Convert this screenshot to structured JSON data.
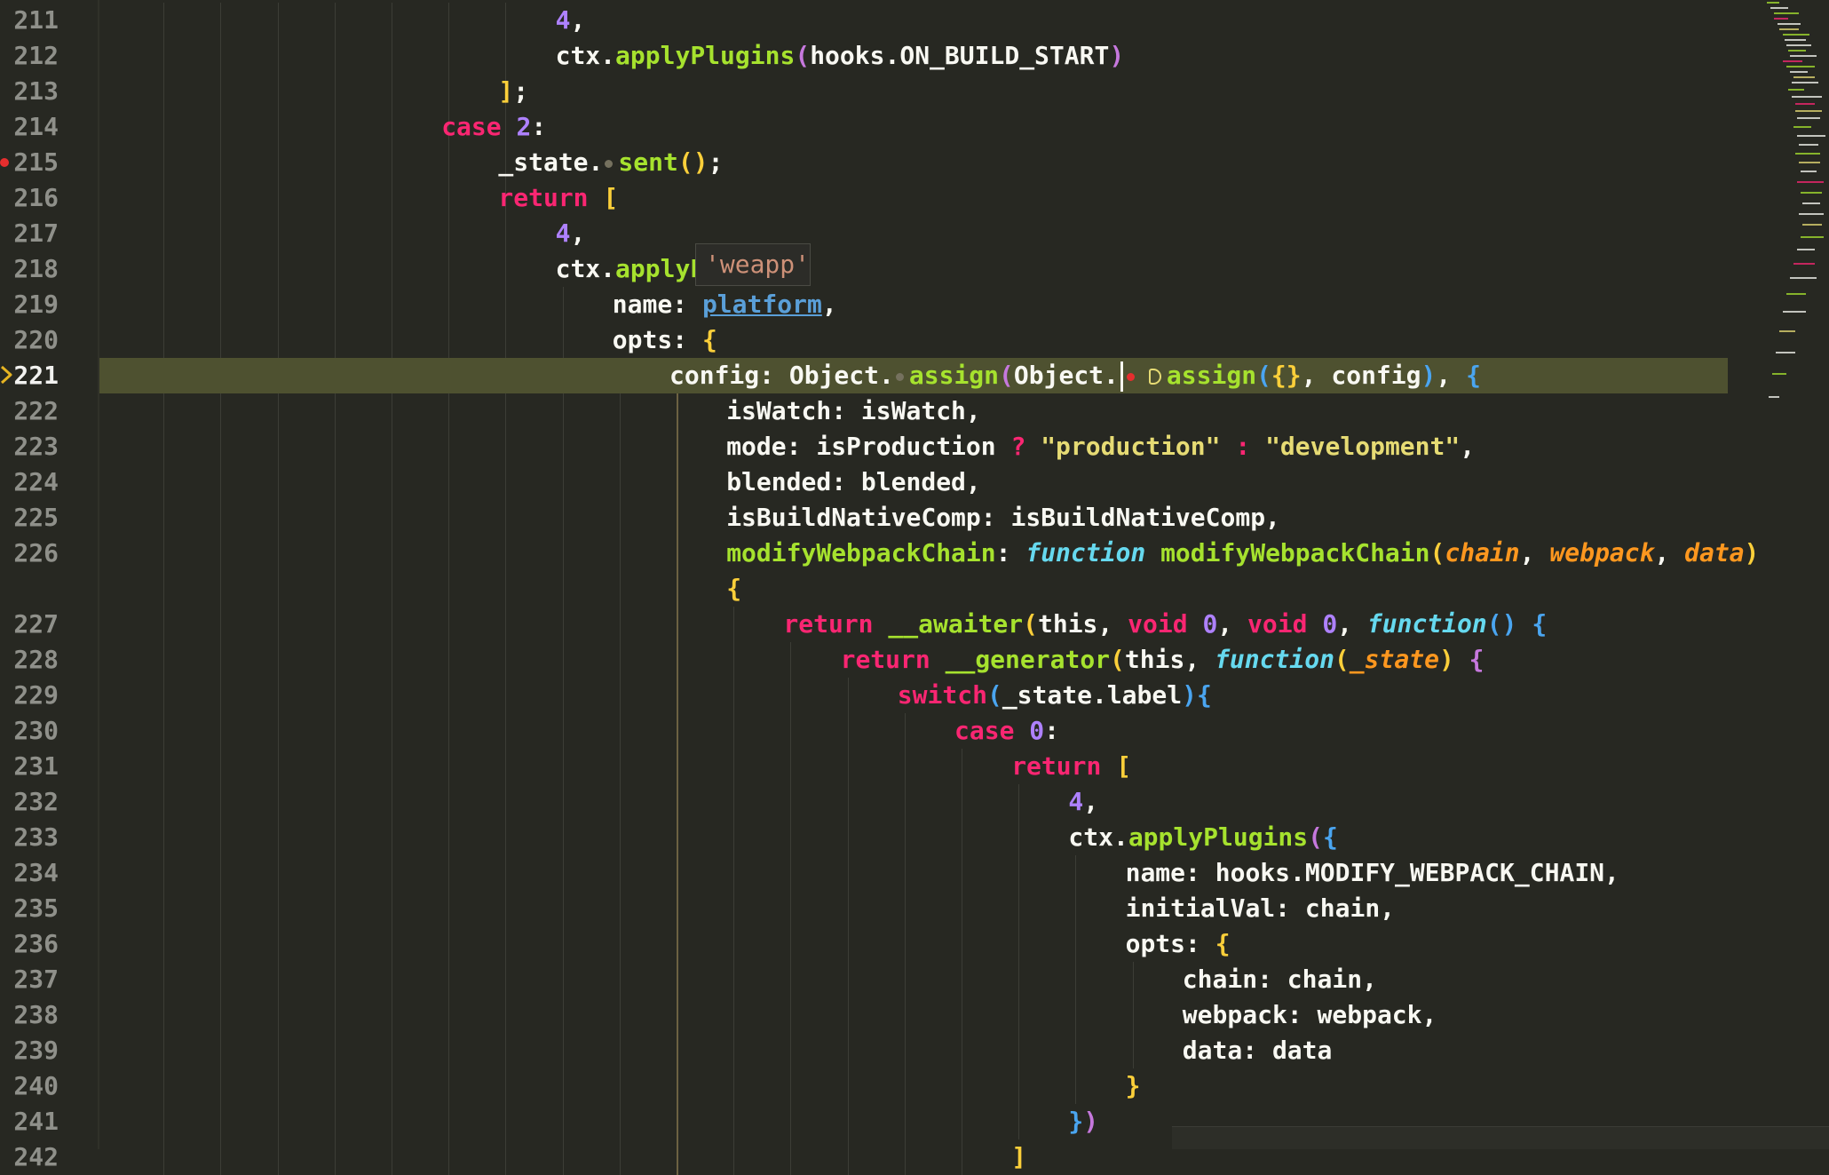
{
  "editor": {
    "colors": {
      "background": "#272822",
      "line_highlight": "#4e5130",
      "plain": "#f8f8f2",
      "keyword": "#f92672",
      "number": "#ae81ff",
      "function": "#a6e22e",
      "string": "#e6db74",
      "storage": "#66d9ef",
      "param": "#fd971f",
      "bracket1": "#fbcf3a",
      "bracket2": "#c678dd",
      "bracket3": "#4aa5f0"
    },
    "tooltip": {
      "text": "'weapp'"
    },
    "breakpoint_line": "215",
    "current_line": "221",
    "lines": [
      {
        "num": "211",
        "indent": 8,
        "tokens": [
          [
            "4",
            "n"
          ],
          [
            ",",
            "p"
          ]
        ]
      },
      {
        "num": "212",
        "indent": 8,
        "tokens": [
          [
            "ctx",
            "p"
          ],
          [
            ".",
            "p"
          ],
          [
            "applyPlugins",
            "f"
          ],
          [
            "(",
            "b2"
          ],
          [
            "hooks.ON_BUILD_START",
            "p"
          ],
          [
            ")",
            "b2"
          ]
        ]
      },
      {
        "num": "213",
        "indent": 7,
        "tokens": [
          [
            "]",
            "b1"
          ],
          [
            ";",
            "p"
          ]
        ]
      },
      {
        "num": "214",
        "indent": 6,
        "tokens": [
          [
            "case ",
            "k"
          ],
          [
            "2",
            "n"
          ],
          [
            ":",
            "p"
          ]
        ]
      },
      {
        "num": "215",
        "indent": 7,
        "tokens": [
          [
            "_state.",
            "p"
          ],
          [
            "@dot",
            ""
          ],
          [
            "sent",
            "f"
          ],
          [
            "()",
            "b1"
          ],
          [
            ";",
            "p"
          ]
        ]
      },
      {
        "num": "216",
        "indent": 7,
        "tokens": [
          [
            "return ",
            "k"
          ],
          [
            "[",
            "b1"
          ]
        ]
      },
      {
        "num": "217",
        "indent": 8,
        "tokens": [
          [
            "4",
            "n"
          ],
          [
            ",",
            "p"
          ]
        ]
      },
      {
        "num": "218",
        "indent": 8,
        "tokens": [
          [
            "ctx.",
            "p"
          ],
          [
            "applyP",
            "f"
          ]
        ]
      },
      {
        "num": "219",
        "indent": 9,
        "tokens": [
          [
            "name: ",
            "p"
          ],
          [
            "platform",
            "link"
          ],
          [
            ",",
            "p"
          ]
        ]
      },
      {
        "num": "220",
        "indent": 9,
        "tokens": [
          [
            "opts: ",
            "p"
          ],
          [
            "{",
            "b1"
          ]
        ]
      },
      {
        "num": "221",
        "indent": 10,
        "tokens": [
          [
            "config: Object.",
            "p"
          ],
          [
            "@dot",
            ""
          ],
          [
            "assign",
            "f"
          ],
          [
            "(",
            "b2"
          ],
          [
            "Object.",
            "p"
          ],
          [
            "@cursor",
            ""
          ],
          [
            "@reddot",
            ""
          ],
          [
            "@hint",
            ""
          ],
          [
            "assign",
            "f"
          ],
          [
            "(",
            "b3"
          ],
          [
            "{}",
            "b1"
          ],
          [
            ", config",
            "p"
          ],
          [
            ")",
            "b3"
          ],
          [
            ", ",
            "p"
          ],
          [
            "{",
            "b3"
          ]
        ]
      },
      {
        "num": "222",
        "indent": 11,
        "tokens": [
          [
            "isWatch: isWatch,",
            "p"
          ]
        ]
      },
      {
        "num": "223",
        "indent": 11,
        "tokens": [
          [
            "mode: isProduction ",
            "p"
          ],
          [
            "? ",
            "k"
          ],
          [
            "\"production\"",
            "s"
          ],
          [
            " ",
            "p"
          ],
          [
            ": ",
            "k"
          ],
          [
            "\"development\"",
            "s"
          ],
          [
            ",",
            "p"
          ]
        ]
      },
      {
        "num": "224",
        "indent": 11,
        "tokens": [
          [
            "blended: blended,",
            "p"
          ]
        ]
      },
      {
        "num": "225",
        "indent": 11,
        "tokens": [
          [
            "isBuildNativeComp: isBuildNativeComp,",
            "p"
          ]
        ]
      },
      {
        "num": "226",
        "indent": 11,
        "tokens": [
          [
            "modifyWebpackChain",
            "f"
          ],
          [
            ": ",
            "p"
          ],
          [
            "function ",
            "st"
          ],
          [
            "modifyWebpackChain",
            "f"
          ],
          [
            "(",
            "b1"
          ],
          [
            "chain",
            "pa"
          ],
          [
            ", ",
            "p"
          ],
          [
            "webpack",
            "pa"
          ],
          [
            ", ",
            "p"
          ],
          [
            "data",
            "pa"
          ],
          [
            ")",
            "b1"
          ]
        ]
      },
      {
        "num": "",
        "indent": 11,
        "tokens": [
          [
            "{",
            "b1"
          ]
        ]
      },
      {
        "num": "227",
        "indent": 12,
        "tokens": [
          [
            "return ",
            "k"
          ],
          [
            "__awaiter",
            "f"
          ],
          [
            "(",
            "b1"
          ],
          [
            "this",
            "p"
          ],
          [
            ", ",
            "p"
          ],
          [
            "void ",
            "k"
          ],
          [
            "0",
            "n"
          ],
          [
            ", ",
            "p"
          ],
          [
            "void ",
            "k"
          ],
          [
            "0",
            "n"
          ],
          [
            ", ",
            "p"
          ],
          [
            "function",
            "st"
          ],
          [
            "() ",
            "b3"
          ],
          [
            "{",
            "b3"
          ]
        ]
      },
      {
        "num": "228",
        "indent": 13,
        "tokens": [
          [
            "return ",
            "k"
          ],
          [
            "__generator",
            "f"
          ],
          [
            "(",
            "b1"
          ],
          [
            "this",
            "p"
          ],
          [
            ", ",
            "p"
          ],
          [
            "function",
            "st"
          ],
          [
            "(",
            "b1"
          ],
          [
            "_state",
            "pa"
          ],
          [
            ") ",
            "b1"
          ],
          [
            "{",
            "b2"
          ]
        ]
      },
      {
        "num": "229",
        "indent": 14,
        "tokens": [
          [
            "switch",
            "k"
          ],
          [
            "(",
            "b3"
          ],
          [
            "_state.label",
            "p"
          ],
          [
            ")",
            "b3"
          ],
          [
            "{",
            "b3"
          ]
        ]
      },
      {
        "num": "230",
        "indent": 15,
        "tokens": [
          [
            "case ",
            "k"
          ],
          [
            "0",
            "n"
          ],
          [
            ":",
            "p"
          ]
        ]
      },
      {
        "num": "231",
        "indent": 16,
        "tokens": [
          [
            "return ",
            "k"
          ],
          [
            "[",
            "b1"
          ]
        ]
      },
      {
        "num": "232",
        "indent": 17,
        "tokens": [
          [
            "4",
            "n"
          ],
          [
            ",",
            "p"
          ]
        ]
      },
      {
        "num": "233",
        "indent": 17,
        "tokens": [
          [
            "ctx.",
            "p"
          ],
          [
            "applyPlugins",
            "f"
          ],
          [
            "(",
            "b2"
          ],
          [
            "{",
            "b3"
          ]
        ]
      },
      {
        "num": "234",
        "indent": 18,
        "tokens": [
          [
            "name: hooks.MODIFY_WEBPACK_CHAIN,",
            "p"
          ]
        ]
      },
      {
        "num": "235",
        "indent": 18,
        "tokens": [
          [
            "initialVal: chain,",
            "p"
          ]
        ]
      },
      {
        "num": "236",
        "indent": 18,
        "tokens": [
          [
            "opts: ",
            "p"
          ],
          [
            "{",
            "b1"
          ]
        ]
      },
      {
        "num": "237",
        "indent": 19,
        "tokens": [
          [
            "chain: chain,",
            "p"
          ]
        ]
      },
      {
        "num": "238",
        "indent": 19,
        "tokens": [
          [
            "webpack: webpack,",
            "p"
          ]
        ]
      },
      {
        "num": "239",
        "indent": 19,
        "tokens": [
          [
            "data: data",
            "p"
          ]
        ]
      },
      {
        "num": "240",
        "indent": 18,
        "tokens": [
          [
            "}",
            "b1"
          ]
        ]
      },
      {
        "num": "241",
        "indent": 17,
        "tokens": [
          [
            "}",
            "b3"
          ],
          [
            ")",
            "b2"
          ]
        ]
      },
      {
        "num": "242",
        "indent": 16,
        "tokens": [
          [
            "]",
            "b1"
          ]
        ]
      }
    ]
  }
}
